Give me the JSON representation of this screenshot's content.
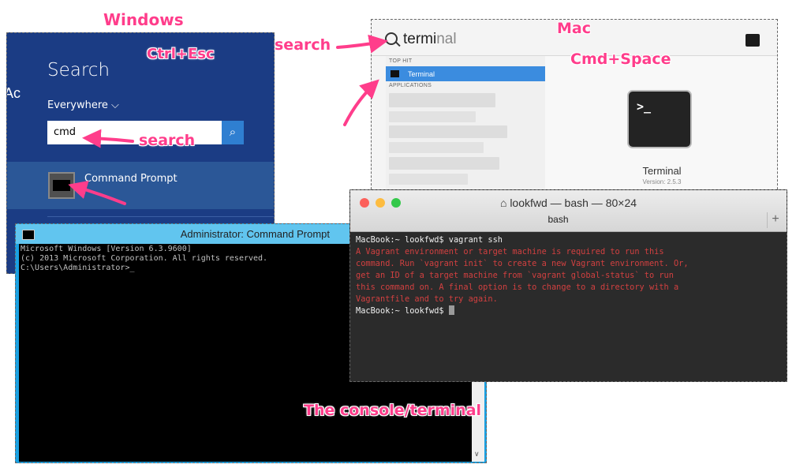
{
  "annotations": {
    "windows": "Windows",
    "ctrl_esc": "Ctrl+Esc",
    "search_windows": "search",
    "search_mac": "search",
    "mac": "Mac",
    "cmd_space": "Cmd+Space",
    "console": "The console/terminal"
  },
  "win_search": {
    "title": "Search",
    "scope": "Everywhere",
    "query": "cmd",
    "result_label": "Command Prompt",
    "search_icon": "search-icon",
    "cropped_text": "Ac"
  },
  "win_cmd": {
    "title": "Administrator: Command Prompt",
    "lines": [
      "Microsoft Windows [Version 6.3.9600]",
      "(c) 2013 Microsoft Corporation. All rights reserved.",
      "",
      "C:\\Users\\Administrator>_"
    ]
  },
  "mac_spotlight": {
    "query_typed": "termi",
    "query_rest": "nal",
    "top_hit_header": "TOP HIT",
    "top_hit": "Terminal",
    "apps_header": "APPLICATIONS",
    "preview_name": "Terminal",
    "preview_version": "Version: 2.5.3",
    "icon_prompt": ">_"
  },
  "mac_terminal": {
    "title": "lookfwd — bash — 80×24",
    "tab": "bash",
    "prompt_line": "MacBook:~ lookfwd$ vagrant ssh",
    "error_lines": [
      "A Vagrant environment or target machine is required to run this",
      "command. Run `vagrant init` to create a new Vagrant environment. Or,",
      "get an ID of a target machine from `vagrant global-status` to run",
      "this command on. A final option is to change to a directory with a",
      "Vagrantfile and to try again."
    ],
    "final_prompt": "MacBook:~ lookfwd$ ",
    "colors": {
      "error": "#d14040",
      "close": "#fc605b",
      "minimize": "#fdbc40",
      "zoom": "#34c84a"
    }
  },
  "colors": {
    "annotation": "#ff3d8b",
    "win_blue": "#1b3c84",
    "cmd_titlebar": "#61c5ef"
  }
}
